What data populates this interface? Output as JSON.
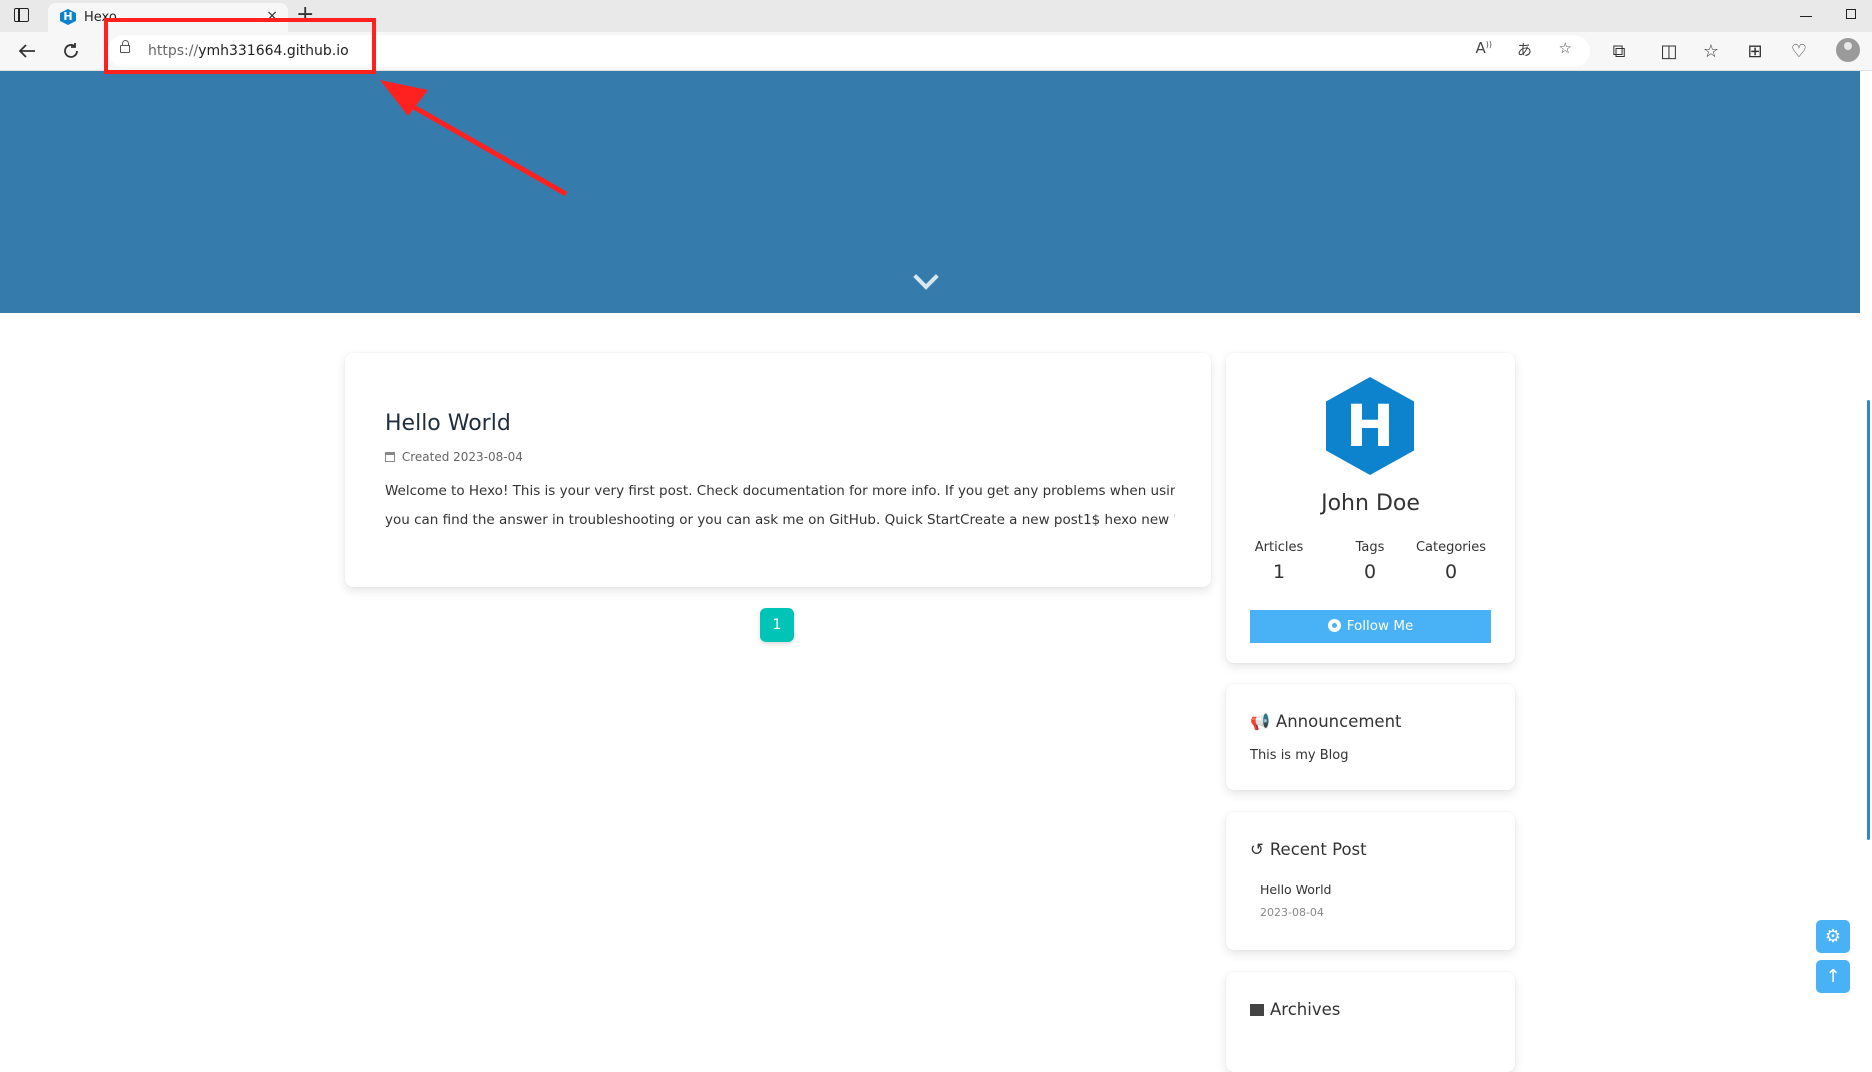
{
  "browser": {
    "tab_title": "Hexo",
    "tab_close": "×",
    "new_tab": "+",
    "url_scheme": "https://",
    "url_host": "ymh331664.github.io"
  },
  "hero": {},
  "post": {
    "title": "Hello World",
    "meta_label": "Created",
    "date": "2023-08-04",
    "excerpt_line1": "Welcome to Hexo! This is your very first post. Check documentation for more info. If you get any problems when using Hexo,",
    "excerpt_line2": "you can find the answer in troubleshooting or you can ask me on GitHub. Quick StartCreate a new post1$ hexo new \"My New..."
  },
  "pagination": {
    "current": "1"
  },
  "author": {
    "logo_letter": "H",
    "name": "John Doe",
    "stats": [
      {
        "label": "Articles",
        "count": "1"
      },
      {
        "label": "Tags",
        "count": "0"
      },
      {
        "label": "Categories",
        "count": "0"
      }
    ],
    "follow_label": "Follow Me"
  },
  "announcement": {
    "title": "Announcement",
    "text": "This is my Blog"
  },
  "recent_post": {
    "title": "Recent Post",
    "items": [
      {
        "title": "Hello World",
        "date": "2023-08-04"
      }
    ]
  },
  "archives": {
    "title": "Archives"
  },
  "colors": {
    "hero": "#357cac",
    "accent_blue": "#49b1f5",
    "page_teal": "#00c4b6",
    "annotation_red": "#ff2020"
  }
}
